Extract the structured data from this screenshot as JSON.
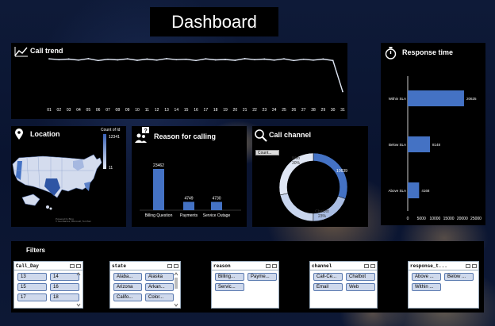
{
  "header": {
    "title": "Dashboard"
  },
  "colors": {
    "accent": "#4472c4",
    "panel": "#000000"
  },
  "call_trend": {
    "title": "Call trend",
    "icon": "line-chart-icon",
    "days": [
      "01",
      "02",
      "03",
      "04",
      "05",
      "06",
      "07",
      "08",
      "09",
      "10",
      "11",
      "12",
      "13",
      "14",
      "15",
      "16",
      "17",
      "18",
      "19",
      "20",
      "21",
      "22",
      "23",
      "24",
      "25",
      "26",
      "27",
      "28",
      "29",
      "30",
      "31"
    ],
    "values": [
      1080,
      1060,
      1075,
      1050,
      1085,
      1040,
      1070,
      1055,
      1080,
      1045,
      1075,
      1050,
      1085,
      1060,
      1070,
      1040,
      1080,
      1055,
      1065,
      1045,
      1085,
      1060,
      1075,
      1050,
      1080,
      1040,
      1070,
      1050,
      1075,
      1040,
      280
    ]
  },
  "response_time": {
    "title": "Response time",
    "icon": "stopwatch-icon",
    "categories": [
      "Within SLA",
      "Below SLA",
      "Above SLA"
    ],
    "values": [
      20625,
      8148,
      4168
    ],
    "value_labels": [
      "20625",
      "8148",
      "4168"
    ],
    "ticks": [
      "0",
      "5000",
      "10000",
      "15000",
      "20000",
      "25000"
    ]
  },
  "location": {
    "title": "Location",
    "icon": "map-pin-icon",
    "legend_title": "Count of Id",
    "legend_max": "12341",
    "legend_min": "11",
    "credit": "Powered by Bing\n© GeoNames, Microsoft, TomTom"
  },
  "reason": {
    "title": "Reason for calling",
    "icon": "people-question-icon",
    "categories": [
      "Billing Question",
      "Payments",
      "Service Outage"
    ],
    "values": [
      23462,
      4749,
      4730
    ],
    "value_labels": [
      "23462",
      "4749",
      "4730"
    ]
  },
  "channel": {
    "title": "Call channel",
    "icon": "magnifier-icon",
    "filter_button": "Count...",
    "slices": [
      {
        "name": "Call-Center",
        "value": 10639,
        "color": "#4472c4"
      },
      {
        "name": "Chatbot",
        "value": 6800,
        "color": "#a9bde3"
      },
      {
        "name": "Email",
        "value": 7400,
        "color": "#c8d5ee"
      },
      {
        "name": "Web",
        "value": 10000,
        "color": "#dfe6f4"
      }
    ],
    "labels": {
      "web": "Web",
      "web_pct": "30%",
      "call": "10639",
      "chatbot": "Chatbot",
      "chatbot_pct": "23%"
    }
  },
  "filters": {
    "title": "Filters",
    "call_day": {
      "header": "Call_Day",
      "items": [
        "13",
        "14",
        "15",
        "16",
        "17",
        "18"
      ]
    },
    "state": {
      "header": "state",
      "items": [
        "Alaba...",
        "Alaska",
        "Arizona",
        "Arkan...",
        "Califo...",
        "Color..."
      ]
    },
    "reason": {
      "header": "reason",
      "items": [
        "Billing...",
        "Payme...",
        "Servic..."
      ]
    },
    "channel": {
      "header": "channel",
      "items": [
        "Call-Ce...",
        "Chatbot",
        "Email",
        "Web"
      ]
    },
    "response": {
      "header": "response_t...",
      "items": [
        "Above ...",
        "Below ...",
        "Within ..."
      ]
    }
  }
}
